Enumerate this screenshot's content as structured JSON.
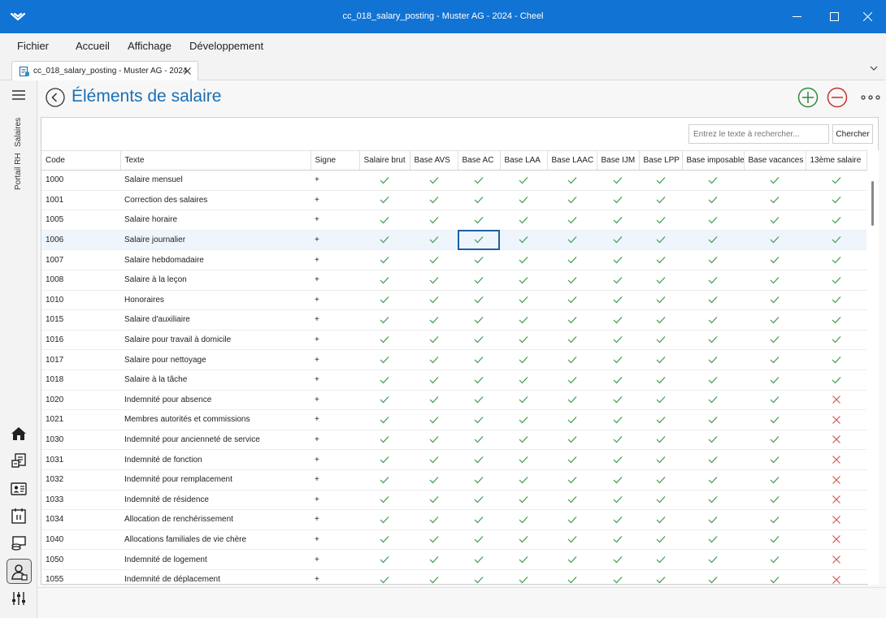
{
  "window": {
    "title": "cc_018_salary_posting - Muster AG - 2024 - Cheel",
    "accent": "#1173d4"
  },
  "menu": {
    "fichier": "Fichier",
    "accueil": "Accueil",
    "affichage": "Affichage",
    "developpement": "Développement"
  },
  "doc_tab": {
    "label": "cc_018_salary_posting - Muster AG - 2024"
  },
  "leftnav": {
    "salaires": "Salaires",
    "portail_rh": "Portail RH",
    "icons": [
      "home-icon",
      "payroll-icon",
      "employee-card-icon",
      "calendar-icon",
      "coins-icon",
      "hr-person-icon",
      "settings-sliders-icon"
    ]
  },
  "page": {
    "title": "Éléments de salaire",
    "search_placeholder": "Entrez le texte à rechercher...",
    "search_button": "Chercher"
  },
  "table": {
    "columns": [
      "Code",
      "Texte",
      "Signe",
      "Salaire brut",
      "Base AVS",
      "Base AC",
      "Base LAA",
      "Base LAAC",
      "Base IJM",
      "Base LPP",
      "Base imposable",
      "Base vacances",
      "13ème salaire"
    ],
    "selected_row_code": "1006",
    "focused_column": "Base AC",
    "rows": [
      {
        "code": "1000",
        "texte": "Salaire mensuel",
        "signe": "+",
        "flags": [
          true,
          true,
          true,
          true,
          true,
          true,
          true,
          true,
          true,
          true
        ]
      },
      {
        "code": "1001",
        "texte": "Correction des salaires",
        "signe": "+",
        "flags": [
          true,
          true,
          true,
          true,
          true,
          true,
          true,
          true,
          true,
          true
        ]
      },
      {
        "code": "1005",
        "texte": "Salaire horaire",
        "signe": "+",
        "flags": [
          true,
          true,
          true,
          true,
          true,
          true,
          true,
          true,
          true,
          true
        ]
      },
      {
        "code": "1006",
        "texte": "Salaire journalier",
        "signe": "+",
        "flags": [
          true,
          true,
          true,
          true,
          true,
          true,
          true,
          true,
          true,
          true
        ]
      },
      {
        "code": "1007",
        "texte": "Salaire hebdomadaire",
        "signe": "+",
        "flags": [
          true,
          true,
          true,
          true,
          true,
          true,
          true,
          true,
          true,
          true
        ]
      },
      {
        "code": "1008",
        "texte": "Salaire à la leçon",
        "signe": "+",
        "flags": [
          true,
          true,
          true,
          true,
          true,
          true,
          true,
          true,
          true,
          true
        ]
      },
      {
        "code": "1010",
        "texte": "Honoraires",
        "signe": "+",
        "flags": [
          true,
          true,
          true,
          true,
          true,
          true,
          true,
          true,
          true,
          true
        ]
      },
      {
        "code": "1015",
        "texte": "Salaire d'auxiliaire",
        "signe": "+",
        "flags": [
          true,
          true,
          true,
          true,
          true,
          true,
          true,
          true,
          true,
          true
        ]
      },
      {
        "code": "1016",
        "texte": "Salaire pour travail à domicile",
        "signe": "+",
        "flags": [
          true,
          true,
          true,
          true,
          true,
          true,
          true,
          true,
          true,
          true
        ]
      },
      {
        "code": "1017",
        "texte": "Salaire pour nettoyage",
        "signe": "+",
        "flags": [
          true,
          true,
          true,
          true,
          true,
          true,
          true,
          true,
          true,
          true
        ]
      },
      {
        "code": "1018",
        "texte": "Salaire à la tâche",
        "signe": "+",
        "flags": [
          true,
          true,
          true,
          true,
          true,
          true,
          true,
          true,
          true,
          true
        ]
      },
      {
        "code": "1020",
        "texte": "Indemnité pour absence",
        "signe": "+",
        "flags": [
          true,
          true,
          true,
          true,
          true,
          true,
          true,
          true,
          true,
          false
        ]
      },
      {
        "code": "1021",
        "texte": "Membres autorités et commissions",
        "signe": "+",
        "flags": [
          true,
          true,
          true,
          true,
          true,
          true,
          true,
          true,
          true,
          false
        ]
      },
      {
        "code": "1030",
        "texte": "Indemnité pour ancienneté de service",
        "signe": "+",
        "flags": [
          true,
          true,
          true,
          true,
          true,
          true,
          true,
          true,
          true,
          false
        ]
      },
      {
        "code": "1031",
        "texte": "Indemnité de fonction",
        "signe": "+",
        "flags": [
          true,
          true,
          true,
          true,
          true,
          true,
          true,
          true,
          true,
          false
        ]
      },
      {
        "code": "1032",
        "texte": "Indemnité pour remplacement",
        "signe": "+",
        "flags": [
          true,
          true,
          true,
          true,
          true,
          true,
          true,
          true,
          true,
          false
        ]
      },
      {
        "code": "1033",
        "texte": "Indemnité de résidence",
        "signe": "+",
        "flags": [
          true,
          true,
          true,
          true,
          true,
          true,
          true,
          true,
          true,
          false
        ]
      },
      {
        "code": "1034",
        "texte": "Allocation de renchérissement",
        "signe": "+",
        "flags": [
          true,
          true,
          true,
          true,
          true,
          true,
          true,
          true,
          true,
          false
        ]
      },
      {
        "code": "1040",
        "texte": "Allocations familiales de vie chère",
        "signe": "+",
        "flags": [
          true,
          true,
          true,
          true,
          true,
          true,
          true,
          true,
          true,
          false
        ]
      },
      {
        "code": "1050",
        "texte": "Indemnité de logement",
        "signe": "+",
        "flags": [
          true,
          true,
          true,
          true,
          true,
          true,
          true,
          true,
          true,
          false
        ]
      },
      {
        "code": "1055",
        "texte": "Indemnité de déplacement",
        "signe": "+",
        "flags": [
          true,
          true,
          true,
          true,
          true,
          true,
          true,
          true,
          true,
          false
        ]
      }
    ]
  },
  "colors": {
    "check": "#3a9a4a",
    "cross": "#d9534f",
    "title_blue": "#1a6fb5",
    "add_green": "#2e8b3e",
    "remove_red": "#c9302c"
  }
}
